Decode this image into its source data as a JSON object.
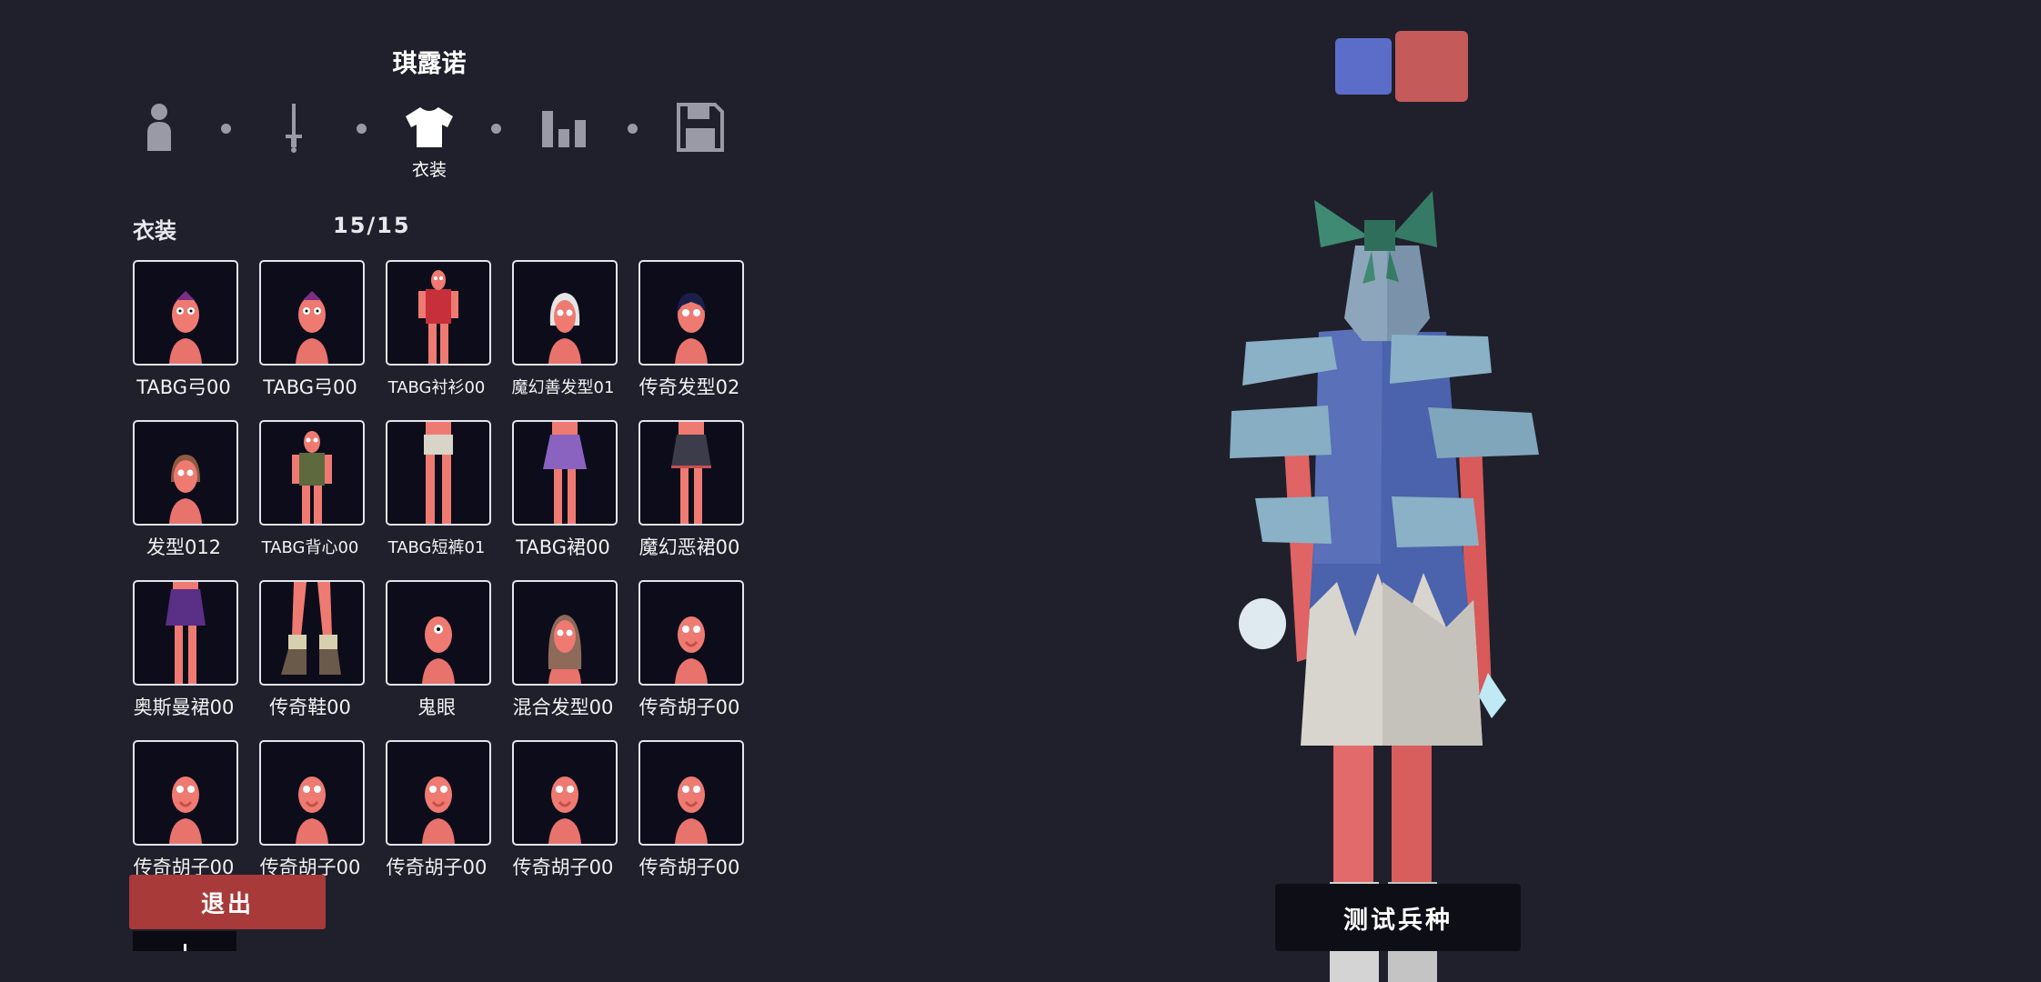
{
  "unit": {
    "name": "琪露诺"
  },
  "steps": [
    {
      "icon": "person-icon",
      "label": ""
    },
    {
      "icon": "sword-icon",
      "label": ""
    },
    {
      "icon": "shirt-icon",
      "label": "衣装",
      "active": true
    },
    {
      "icon": "bar-chart-icon",
      "label": ""
    },
    {
      "icon": "floppy-disk-icon",
      "label": ""
    }
  ],
  "outfit": {
    "title": "衣装",
    "count": "15/15",
    "items": [
      "TABG弓00",
      "TABG弓00",
      "TABG衬衫00",
      "魔幻善发型01",
      "传奇发型02",
      "发型012",
      "TABG背心00",
      "TABG短裤01",
      "TABG裙00",
      "魔幻恶裙00",
      "奥斯曼裙00",
      "传奇鞋00",
      "鬼眼",
      "混合发型00",
      "传奇胡子00",
      "传奇胡子00",
      "传奇胡子00",
      "传奇胡子00",
      "传奇胡子00",
      "传奇胡子00"
    ]
  },
  "buttons": {
    "exit": "退出",
    "test_unit": "测试兵种"
  },
  "colors": {
    "team_blue": "#5c6dc9",
    "team_red": "#c55a5a",
    "exit_bg": "#a83a3a"
  }
}
